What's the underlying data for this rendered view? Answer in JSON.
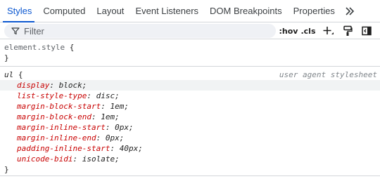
{
  "tabs": [
    {
      "label": "Styles",
      "active": true
    },
    {
      "label": "Computed",
      "active": false
    },
    {
      "label": "Layout",
      "active": false
    },
    {
      "label": "Event Listeners",
      "active": false
    },
    {
      "label": "DOM Breakpoints",
      "active": false
    },
    {
      "label": "Properties",
      "active": false
    }
  ],
  "toolbar": {
    "filter_placeholder": "Filter",
    "hov_label": ":hov",
    "cls_label": ".cls",
    "icons": {
      "filter": "filter-funnel-icon",
      "more_tabs": "chevron-double-right-icon",
      "new_rule": "plus-icon",
      "color_format": "paint-roller-icon",
      "sidebar": "toggle-sidebar-icon"
    }
  },
  "element_style": {
    "selector": "element.style",
    "open": " {",
    "close": "}"
  },
  "ua_rule": {
    "selector": "ul",
    "open": " {",
    "close": "}",
    "origin": "user agent stylesheet",
    "declarations": [
      {
        "prop": "display",
        "value": "block"
      },
      {
        "prop": "list-style-type",
        "value": "disc"
      },
      {
        "prop": "margin-block-start",
        "value": "1em"
      },
      {
        "prop": "margin-block-end",
        "value": "1em"
      },
      {
        "prop": "margin-inline-start",
        "value": "0px"
      },
      {
        "prop": "margin-inline-end",
        "value": "0px"
      },
      {
        "prop": "padding-inline-start",
        "value": "40px"
      },
      {
        "prop": "unicode-bidi",
        "value": "isolate"
      }
    ]
  },
  "colors": {
    "accent": "#0b57d0",
    "property": "#c80000",
    "filter_bg": "#eff1f5",
    "divider": "#d3d6da",
    "origin_text": "#80868b"
  }
}
